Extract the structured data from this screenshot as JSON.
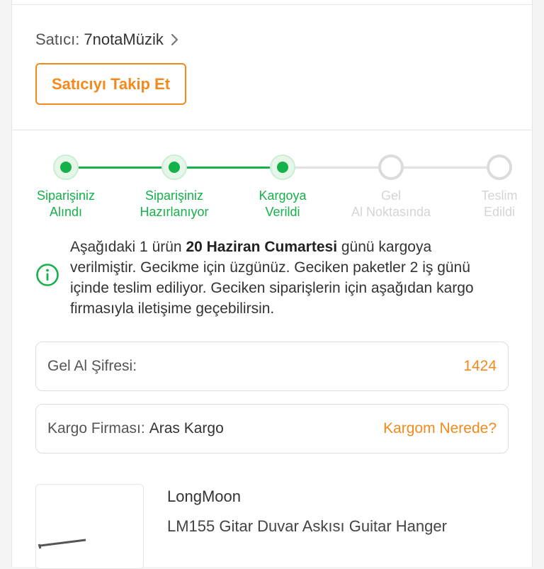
{
  "seller": {
    "label": "Satıcı:",
    "name": "7notaMüzik",
    "follow_button": "Satıcıyı Takip Et"
  },
  "tracker": {
    "steps": [
      {
        "line1": "Siparişiniz",
        "line2": "Alındı",
        "status": "done"
      },
      {
        "line1": "Siparişiniz",
        "line2": "Hazırlanıyor",
        "status": "done"
      },
      {
        "line1": "Kargoya",
        "line2": "Verildi",
        "status": "done"
      },
      {
        "line1": "Gel",
        "line2": "Al Noktasında",
        "status": "todo"
      },
      {
        "line1": "Teslim",
        "line2": "Edildi",
        "status": "todo"
      }
    ],
    "colors": {
      "done": "#15b14a",
      "todo": "#dcdcdc"
    }
  },
  "info": {
    "icon": "info-circle-icon",
    "text_before": "Aşağıdaki 1 ürün ",
    "text_bold": "20 Haziran Cumartesi",
    "text_after": " günü kargoya verilmiştir. Gecikme için üzgünüz. Geciken paketler 2 iş günü içinde teslim ediliyor. Geciken siparişlerin için aşağıdan kargo firmasıyla iletişime geçebilirsin."
  },
  "pickup_code": {
    "label": "Gel Al Şifresi:",
    "value": "1424"
  },
  "cargo": {
    "label": "Kargo Firması:",
    "company": "Aras Kargo",
    "link": "Kargom Nerede?"
  },
  "product": {
    "brand": "LongMoon",
    "name": "LM155 Gitar Duvar Askısı Guitar Hanger"
  },
  "accent_color": "#f28a1e"
}
